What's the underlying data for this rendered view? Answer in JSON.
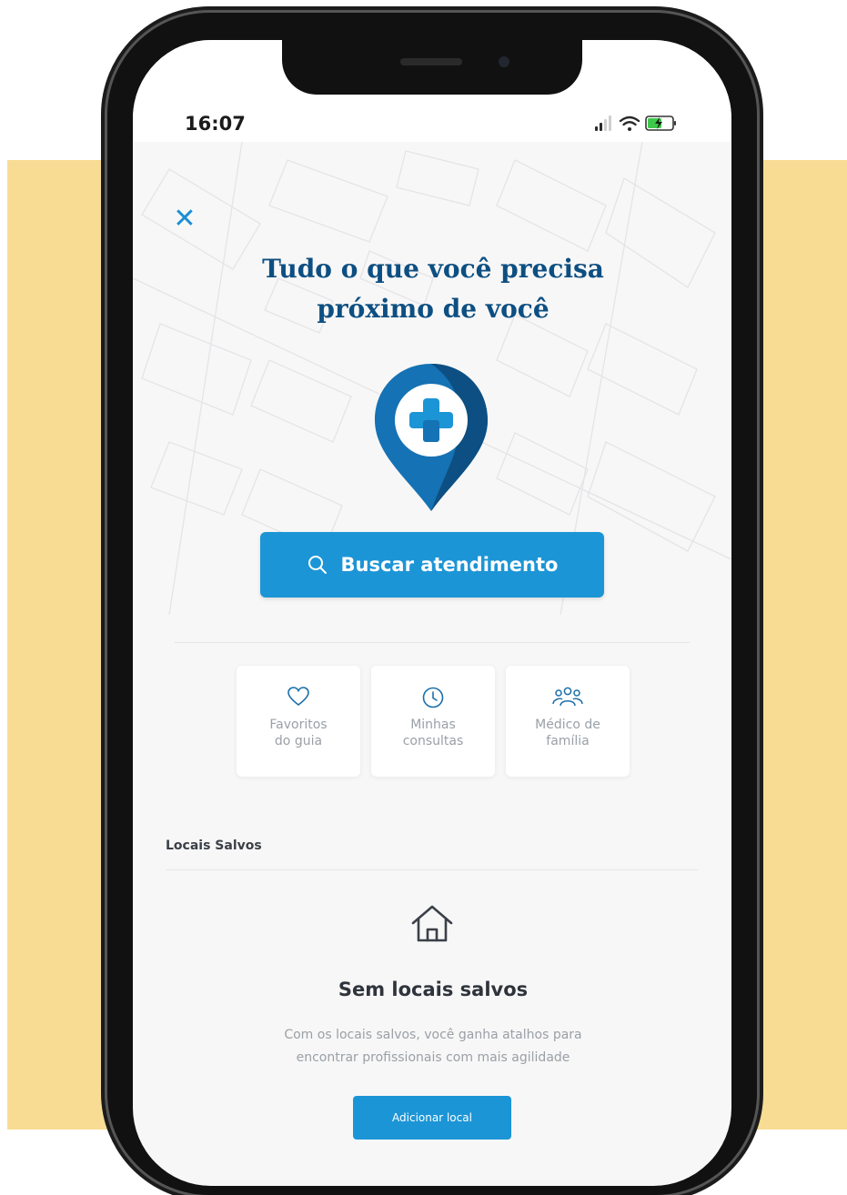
{
  "status_bar": {
    "time": "16:07"
  },
  "header": {
    "title_line1": "Tudo o que você precisa",
    "title_line2": "próximo de você",
    "close_icon": "close-icon"
  },
  "search": {
    "label": "Buscar atendimento",
    "icon": "search-icon"
  },
  "shortcuts": [
    {
      "line1": "Favoritos",
      "line2": "do guia",
      "icon": "heart-icon"
    },
    {
      "line1": "Minhas",
      "line2": "consultas",
      "icon": "clock-icon"
    },
    {
      "line1": "Médico de",
      "line2": "família",
      "icon": "group-icon"
    }
  ],
  "saved": {
    "section_title": "Locais Salvos",
    "empty_title": "Sem locais salvos",
    "empty_desc_line1": "Com os locais salvos, você ganha atalhos para",
    "empty_desc_line2": "encontrar profissionais com mais agilidade",
    "add_label": "Adicionar local",
    "empty_icon": "house-icon"
  },
  "colors": {
    "accent": "#1c95d6",
    "title": "#0d4f82",
    "background_band": "#f8dc93"
  }
}
